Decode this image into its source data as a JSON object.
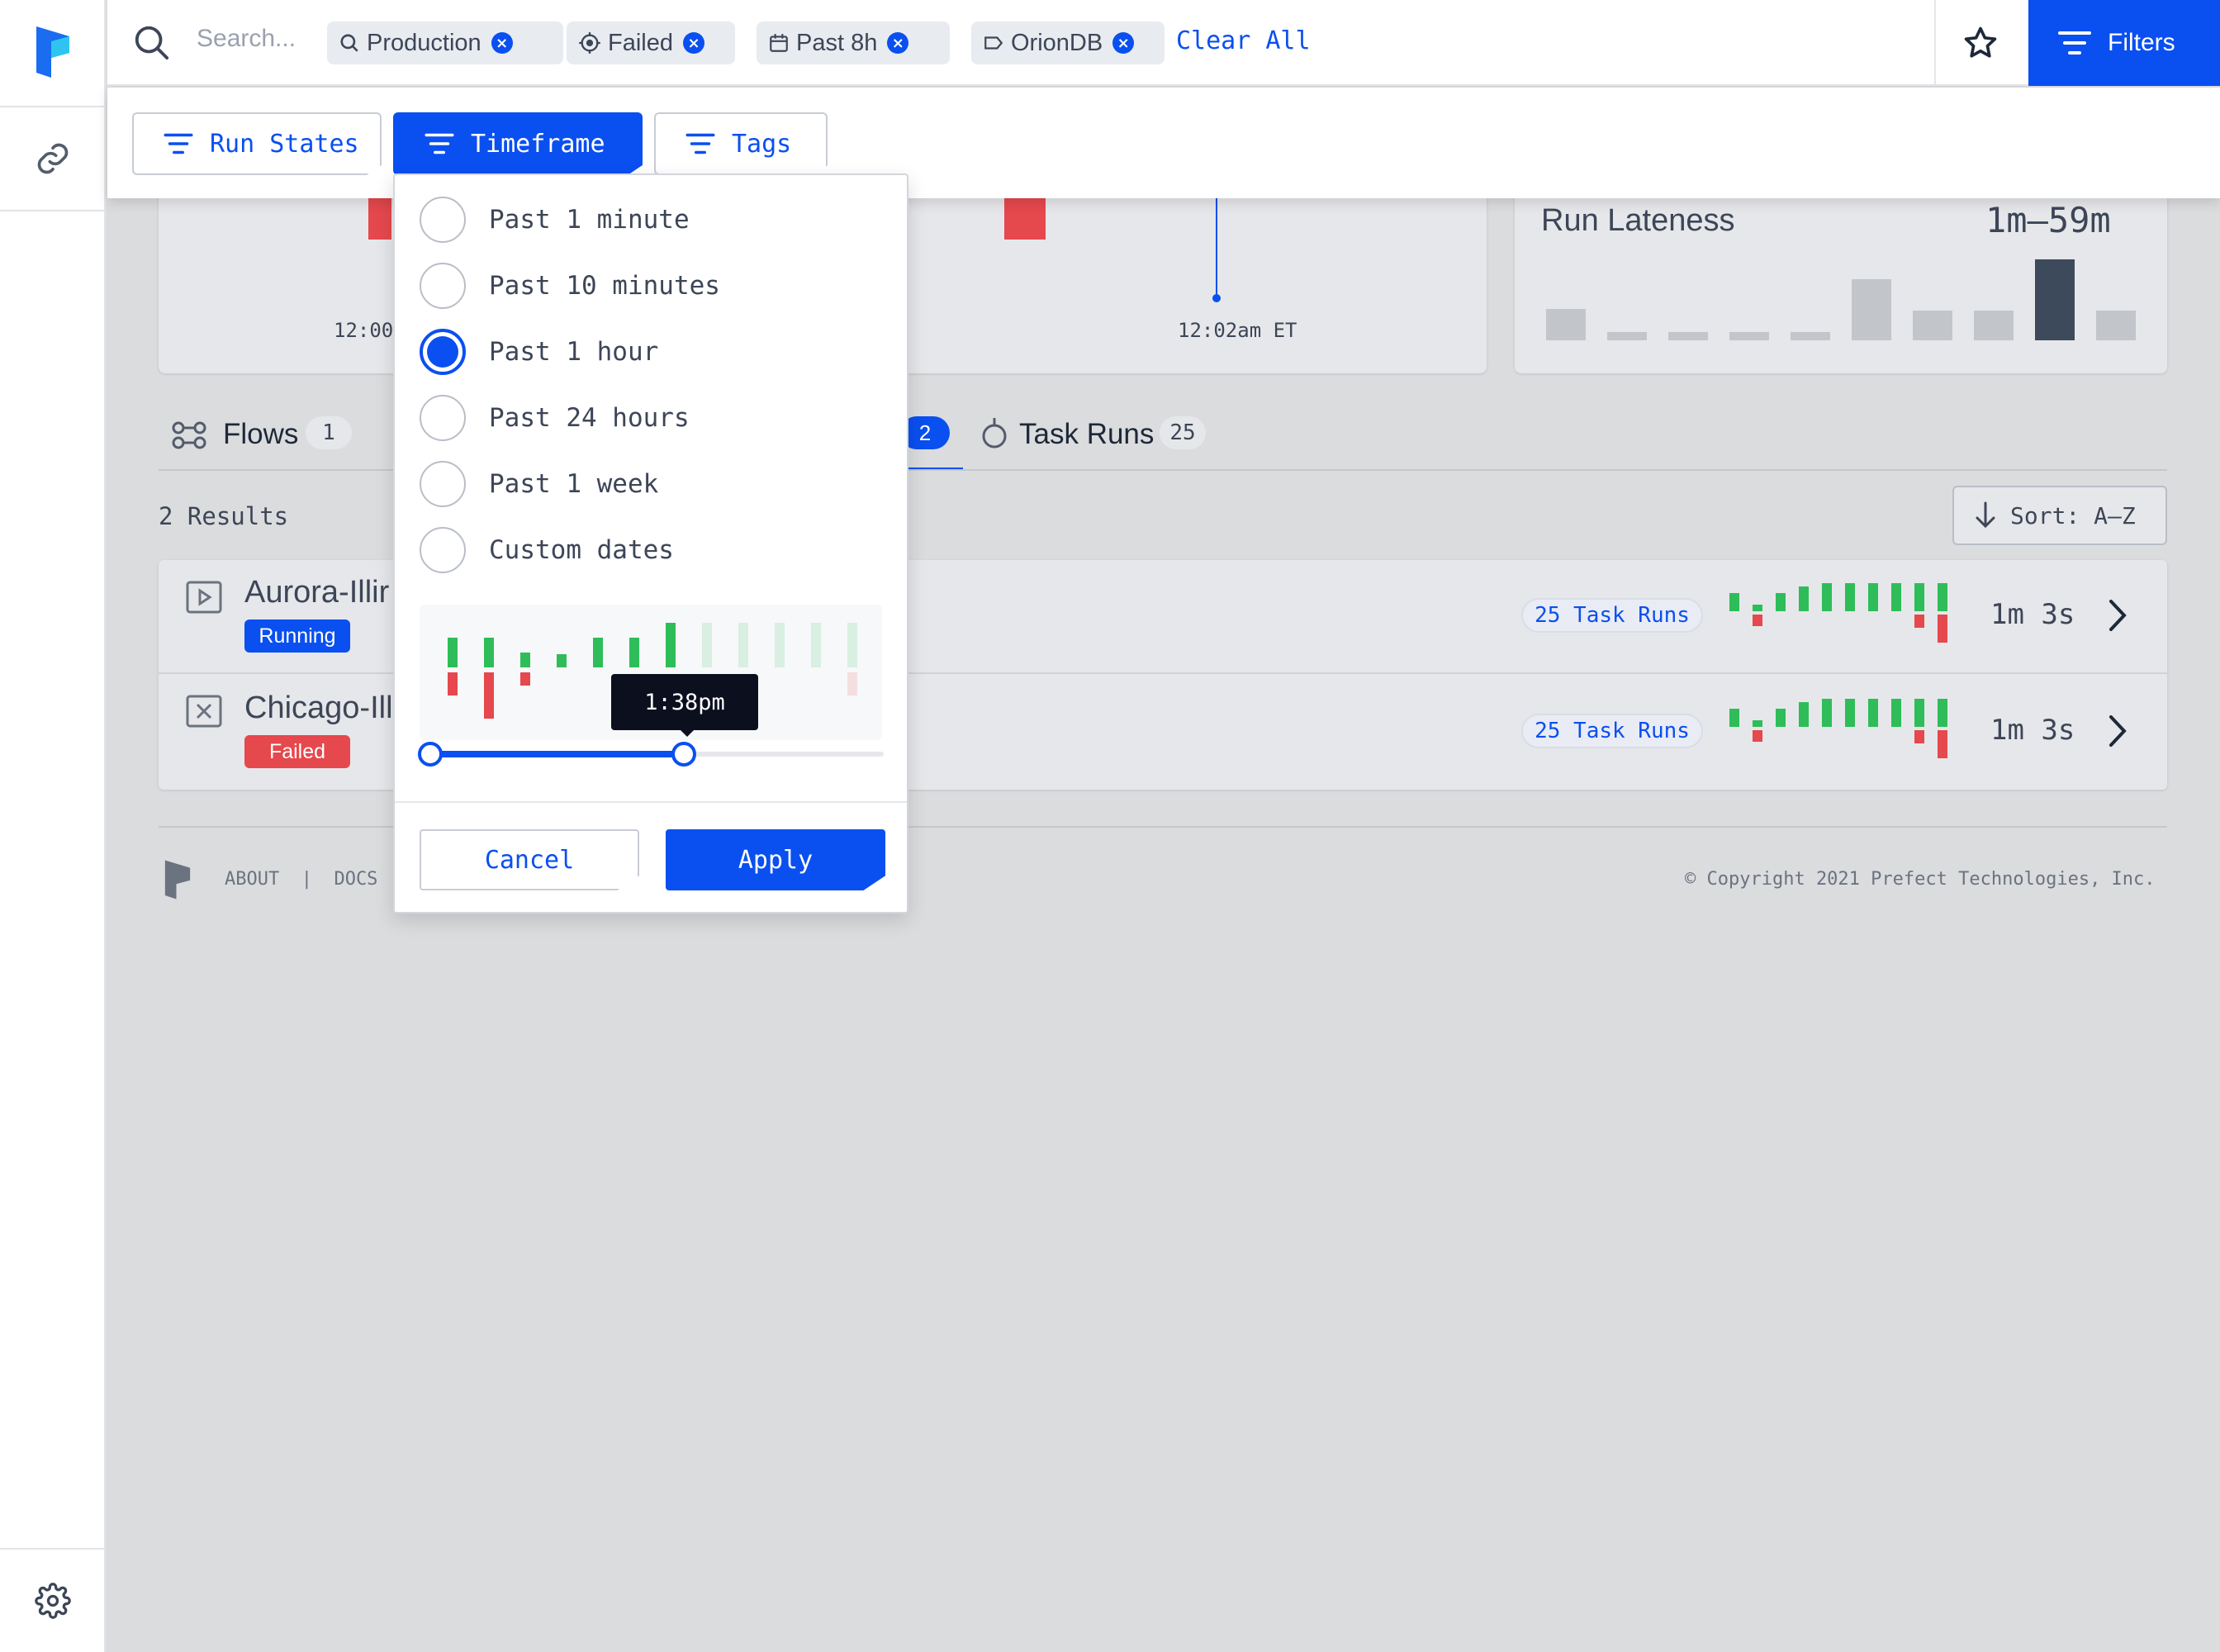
{
  "search": {
    "placeholder": "Search..."
  },
  "chips": [
    {
      "label": "Production",
      "icon": "search-icon"
    },
    {
      "label": "Failed",
      "icon": "target-icon"
    },
    {
      "label": "Past 8h",
      "icon": "calendar-icon"
    },
    {
      "label": "OrionDB",
      "icon": "tag-icon"
    }
  ],
  "clear_all": "Clear All",
  "filters_button": "Filters",
  "filter_tabs": [
    {
      "label": "Run States"
    },
    {
      "label": "Timeframe"
    },
    {
      "label": "Tags"
    }
  ],
  "timeframe": {
    "options": [
      "Past 1 minute",
      "Past 10 minutes",
      "Past 1 hour",
      "Past 24 hours",
      "Past 1 week",
      "Custom dates"
    ],
    "selected": "Past 1 hour",
    "tooltip": "1:38pm",
    "slider_value": 0.55,
    "cancel": "Cancel",
    "apply": "Apply"
  },
  "background": {
    "time_label_left": "12:00",
    "time_label_right": "12:02am ET",
    "run_lateness": {
      "title": "Run Lateness",
      "value": "1m‒59m"
    },
    "tabs": {
      "flows_label": "Flows",
      "flows_count": "1",
      "hidden_count": "2",
      "task_runs_label": "Task Runs",
      "task_runs_count": "25"
    },
    "results": "2 Results",
    "sort": "Sort: A–Z",
    "rows": [
      {
        "name": "Aurora-Illir",
        "status": "Running",
        "status_color": "#0a4ff0",
        "task_runs": "25 Task Runs",
        "duration": "1m 3s"
      },
      {
        "name": "Chicago-Ill",
        "status": "Failed",
        "status_color": "#e5484d",
        "task_runs": "25 Task Runs",
        "duration": "1m 3s"
      }
    ]
  },
  "footer": {
    "links": "ABOUT  |  DOCS  |",
    "copyright": "© Copyright 2021 Prefect Technologies, Inc."
  },
  "colors": {
    "accent": "#0a4ff0",
    "success": "#2ebd59",
    "danger": "#e5484d"
  }
}
